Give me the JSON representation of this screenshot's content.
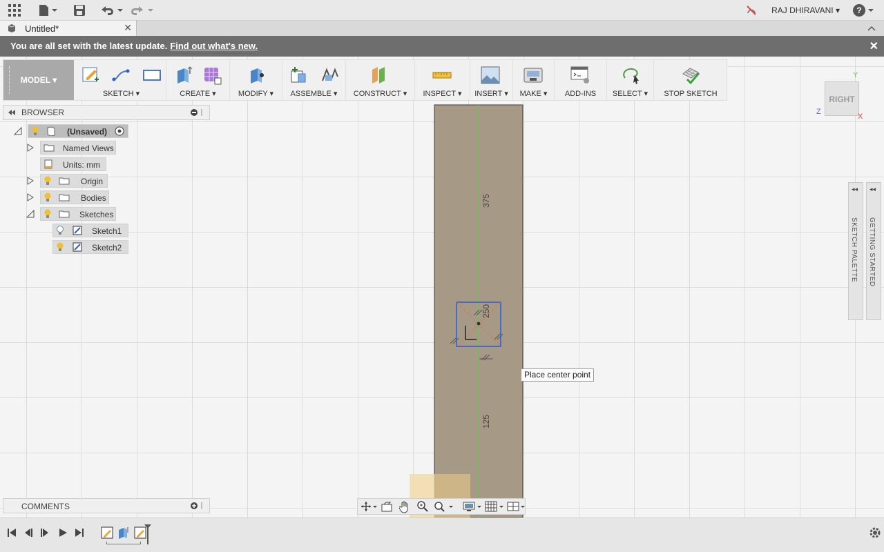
{
  "top_bar": {
    "user_name": "RAJ DHIRAVANI",
    "icons": [
      "apps-grid-icon",
      "file-icon",
      "save-icon",
      "undo-icon",
      "redo-icon",
      "offline-icon",
      "help-icon"
    ]
  },
  "tab": {
    "title": "Untitled*"
  },
  "notification": {
    "message": "You are all set with the latest update.",
    "link": "Find out what's new."
  },
  "toolbar": {
    "model": "MODEL",
    "groups": {
      "sketch": "SKETCH",
      "create": "CREATE",
      "modify": "MODIFY",
      "assemble": "ASSEMBLE",
      "construct": "CONSTRUCT",
      "inspect": "INSPECT",
      "insert": "INSERT",
      "make": "MAKE",
      "addins": "ADD-INS",
      "select": "SELECT",
      "stop_sketch": "STOP SKETCH"
    }
  },
  "browser": {
    "title": "BROWSER",
    "root": "(Unsaved)",
    "named_views": "Named Views",
    "units": "Units: mm",
    "origin": "Origin",
    "bodies": "Bodies",
    "sketches": "Sketches",
    "sketch1": "Sketch1",
    "sketch2": "Sketch2"
  },
  "comments": {
    "title": "COMMENTS"
  },
  "viewport": {
    "dim_top": "375",
    "dim_middle": "250",
    "dim_bottom": "125",
    "tooltip": "Place center point"
  },
  "viewcube": {
    "face": "RIGHT",
    "axis_y": "Y",
    "axis_z": "Z",
    "axis_x": "X"
  },
  "palettes": {
    "sketch": "SKETCH PALETTE",
    "getting_started": "GETTING STARTED"
  },
  "colors": {
    "body_fill": "#a69a87",
    "model_btn": "#a9a9a9",
    "notification_bg": "#6e6e6e",
    "selection_blue": "#2a5bd7",
    "axis_green": "#6cc24a"
  }
}
